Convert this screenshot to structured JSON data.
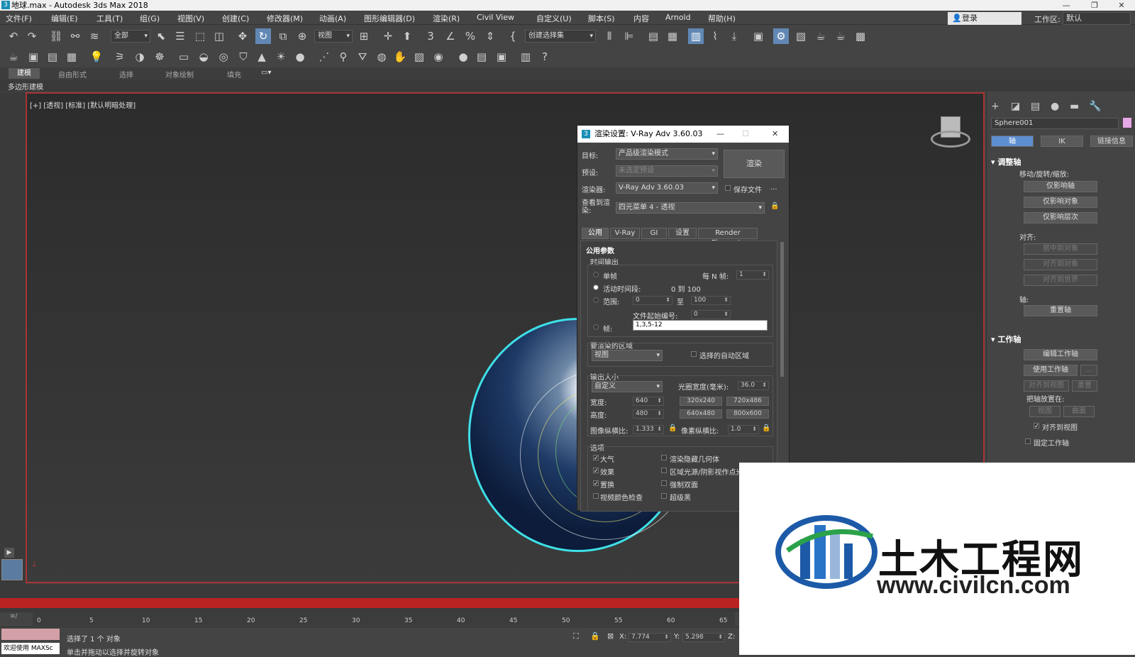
{
  "window": {
    "title": "地球.max - Autodesk 3ds Max 2018",
    "app_icon": "3"
  },
  "menubar": {
    "items": [
      "文件(F)",
      "编辑(E)",
      "工具(T)",
      "组(G)",
      "视图(V)",
      "创建(C)",
      "修改器(M)",
      "动画(A)",
      "图形编辑器(D)",
      "渲染(R)",
      "Civil View",
      "自定义(U)",
      "脚本(S)",
      "内容",
      "Arnold",
      "帮助(H)"
    ],
    "login": "登录",
    "workspace_label": "工作区:",
    "workspace_value": "默认"
  },
  "toolbar": {
    "selection_filter": "全部",
    "ref_coord": "视图",
    "named_selection": "创建选择集"
  },
  "ribbon": {
    "tabs": [
      "建模",
      "自由形式",
      "选择",
      "对象绘制",
      "填充"
    ],
    "subtitle": "多边形建模"
  },
  "viewport": {
    "label": "[+] [透视] [标准] [默认明暗处理]"
  },
  "command_panel": {
    "object_name": "Sphere001",
    "object_color": "#e6a8e6",
    "tabs": [
      "轴",
      "IK",
      "链接信息"
    ],
    "adjust_pivot": {
      "title": "调整轴",
      "move_label": "移动/旋转/缩放:",
      "buttons": [
        "仅影响轴",
        "仅影响对象",
        "仅影响层次"
      ],
      "align_label": "对齐:",
      "align_buttons": [
        "居中到对象",
        "对齐到对象",
        "对齐到世界"
      ],
      "pivot_label": "轴:",
      "reset": "重置轴"
    },
    "working_pivot": {
      "title": "工作轴",
      "edit": "编辑工作轴",
      "use": "使用工作轴",
      "use_more": "...",
      "align_view": "对齐到视图",
      "reset": "重置",
      "place_label": "把轴放置在:",
      "view": "视图",
      "surface": "曲面",
      "align_to_view_cb": "对齐到视图",
      "fixed": "固定工作轴"
    }
  },
  "render_dialog": {
    "title": "渲染设置: V-Ray Adv 3.60.03",
    "target_label": "目标:",
    "target_value": "产品级渲染模式",
    "preset_label": "预设:",
    "preset_value": "未选定预设",
    "renderer_label": "渲染器:",
    "renderer_value": "V-Ray Adv 3.60.03",
    "save_file": "保存文件",
    "more": "...",
    "view_label": "查看到渲染:",
    "view_value": "四元菜单 4 - 透视",
    "render_button": "渲染",
    "tabs": [
      "公用",
      "V-Ray",
      "GI",
      "设置",
      "Render Elements"
    ],
    "common_title": "公用参数",
    "time_output": "时间输出",
    "single": "单帧",
    "every_n": "每 N 帧:",
    "every_n_value": "1",
    "active": "活动时间段:",
    "active_range": "0 到 100",
    "range": "范围:",
    "range_from": "0",
    "range_to_label": "至",
    "range_to": "100",
    "file_start": "文件起始编号:",
    "file_start_value": "0",
    "frames": "帧:",
    "frames_value": "1,3,5-12",
    "area_title": "要渲染的区域",
    "area_value": "视图",
    "auto_region": "选择的自动区域",
    "size_title": "输出大小",
    "size_preset": "自定义",
    "aperture_label": "光圈宽度(毫米):",
    "aperture_value": "36.0",
    "width_label": "宽度:",
    "width_value": "640",
    "height_label": "高度:",
    "height_value": "480",
    "presets": [
      "320x240",
      "720x486",
      "640x480",
      "800x600"
    ],
    "aspect_label": "图像纵横比:",
    "aspect_value": "1.333",
    "pixel_aspect_label": "像素纵横比:",
    "pixel_aspect_value": "1.0",
    "options_title": "选项",
    "options": [
      {
        "label": "大气",
        "checked": true
      },
      {
        "label": "渲染隐藏几何体",
        "checked": false
      },
      {
        "label": "效果",
        "checked": true
      },
      {
        "label": "区域光源/阴影视作点光源",
        "checked": false
      },
      {
        "label": "置换",
        "checked": true
      },
      {
        "label": "强制双面",
        "checked": false
      },
      {
        "label": "视频颜色检查",
        "checked": false
      },
      {
        "label": "超级黑",
        "checked": false
      }
    ]
  },
  "timeline": {
    "ticks": [
      "0",
      "5",
      "10",
      "15",
      "20",
      "25",
      "30",
      "35",
      "40",
      "45",
      "50",
      "55",
      "60",
      "65"
    ]
  },
  "status": {
    "welcome": "欢迎使用 MAXSc",
    "selected": "选择了 1 个 对象",
    "hint": "单击并拖动以选择并旋转对象",
    "x_label": "X:",
    "x_value": "7.774",
    "y_label": "Y:",
    "y_value": "5.298",
    "z_label": "Z:"
  },
  "watermark": {
    "cn": "土木工程网",
    "url": "www.civilcn.com"
  }
}
